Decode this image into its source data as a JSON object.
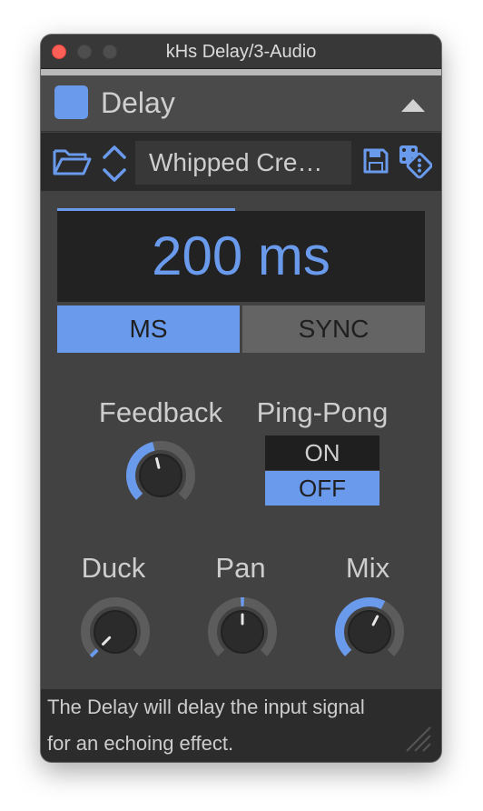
{
  "window": {
    "title": "kHs Delay/3-Audio"
  },
  "device": {
    "name": "Delay",
    "accent": "#6a9aec"
  },
  "preset": {
    "name": "Whipped Cre…"
  },
  "time": {
    "display": "200 ms",
    "mode_options": [
      "MS",
      "SYNC"
    ],
    "selected_mode": "MS"
  },
  "params": {
    "feedback": {
      "label": "Feedback",
      "value": 0.45
    },
    "ping_pong": {
      "label": "Ping-Pong",
      "options": [
        "ON",
        "OFF"
      ],
      "selected": "OFF"
    },
    "duck": {
      "label": "Duck",
      "value": 0.0
    },
    "pan": {
      "label": "Pan",
      "value": 0.5
    },
    "mix": {
      "label": "Mix",
      "value": 0.6
    }
  },
  "info": {
    "line1": "The Delay will delay the input signal",
    "line2": "for an echoing effect."
  },
  "icons": [
    "folder-icon",
    "up-down-arrows-icon",
    "save-icon",
    "randomize-dice-icon",
    "collapse-triangle-icon",
    "resize-grip-icon"
  ]
}
